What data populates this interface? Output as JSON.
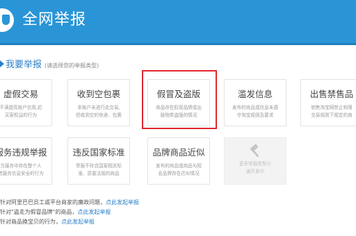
{
  "header": {
    "title": "全网举报"
  },
  "section": {
    "title": "我要举报",
    "hint": "(请选择您的举报类型)"
  },
  "cards": [
    {
      "title": "虚假交易",
      "desc": "不满提高账户信用,赶\n买家权益的行为"
    },
    {
      "title": "收到空包裹",
      "desc": "本账户未进行此交易,\n但收到空的快递、包裹"
    },
    {
      "title": "假冒及盗版",
      "desc": "商品存在假冒品牌或出\n版物类盗版的情况"
    },
    {
      "title": "滥发信息",
      "desc": "发布的商品或信息未遵\n守淘宝规则及要求"
    },
    {
      "title": "出售禁售品",
      "desc": "销售淘宝网禁止和限\n交易规则下规定的商"
    },
    {
      "title": "服务违规举报",
      "desc": "方服务中存在整个人\n者服务信息安全的行为"
    },
    {
      "title": "违反国家标准",
      "desc": "举报不符合国家相关标\n准、质量法规的商品"
    },
    {
      "title": "品牌商品近似",
      "desc": "发布的商品或商品与知\n名品牌存在近似情况"
    },
    {
      "title": "",
      "desc": "更多举报类型火\n速开发中",
      "disabled": true
    }
  ],
  "links": [
    {
      "text": "针对阿里巴巴员工或平台商家的廉政问题，",
      "link": "点此发起举报"
    },
    {
      "text": "针对\"盗走为假冒品牌\"的商品，",
      "link": "点此发起举报"
    },
    {
      "text": "针对商品换宝贝的行为，",
      "link": "点此发起举报"
    }
  ],
  "colors": {
    "header": "#2a95d6",
    "accent": "#2a7fc9",
    "highlight": "#e1262e"
  },
  "icons": {
    "logo": "shield-icon",
    "placeholder": "gavel-icon",
    "section": "triangle-icon"
  }
}
